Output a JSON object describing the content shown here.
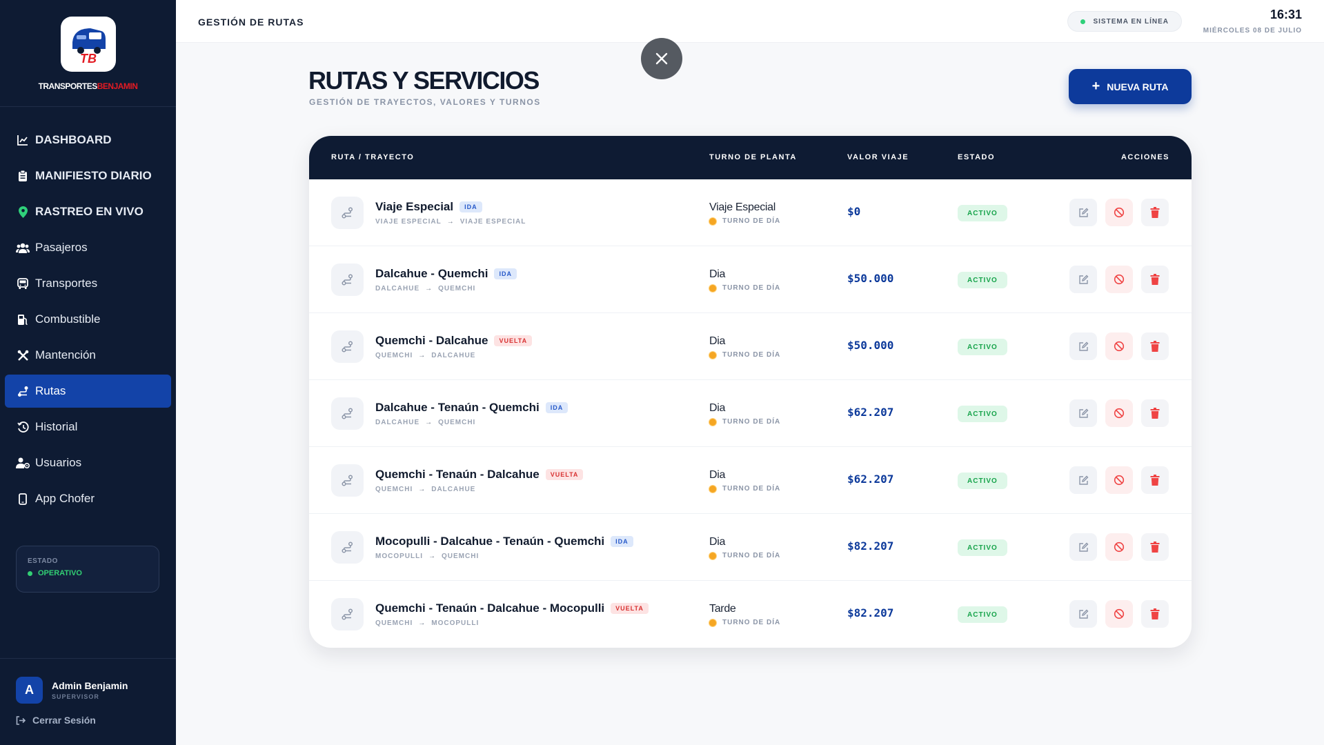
{
  "brand": {
    "logo_text": "TB",
    "name_main": "TRANSPORTES",
    "name_accent": "BENJAMIN"
  },
  "sidebar": {
    "items": [
      {
        "label": "DASHBOARD",
        "icon": "chart-line-icon"
      },
      {
        "label": "MANIFIESTO DIARIO",
        "icon": "clipboard-icon"
      },
      {
        "label": "RASTREO EN VIVO",
        "icon": "map-pin-icon"
      },
      {
        "label": "Pasajeros",
        "icon": "users-icon"
      },
      {
        "label": "Transportes",
        "icon": "bus-icon"
      },
      {
        "label": "Combustible",
        "icon": "fuel-pump-icon"
      },
      {
        "label": "Mantención",
        "icon": "tools-icon"
      },
      {
        "label": "Rutas",
        "icon": "route-icon"
      },
      {
        "label": "Historial",
        "icon": "history-icon"
      },
      {
        "label": "Usuarios",
        "icon": "user-gear-icon"
      },
      {
        "label": "App Chofer",
        "icon": "mobile-icon"
      }
    ],
    "status": {
      "label": "ESTADO",
      "value": "OPERATIVO"
    },
    "user": {
      "initial": "A",
      "name": "Admin Benjamin",
      "role": "SUPERVISOR"
    },
    "logout": "Cerrar Sesión"
  },
  "header": {
    "title": "GESTIÓN DE RUTAS",
    "system_status": "SISTEMA EN LÍNEA",
    "time": "16:31",
    "date": "MIÉRCOLES 08 DE JULIO"
  },
  "main": {
    "title": "RUTAS Y SERVICIOS",
    "subtitle": "GESTIÓN DE TRAYECTOS, VALORES Y TURNOS",
    "new_button": "NUEVA RUTA",
    "columns": {
      "route": "RUTA / TRAYECTO",
      "shift": "TURNO DE PLANTA",
      "value": "VALOR VIAJE",
      "state": "ESTADO",
      "actions": "ACCIONES"
    },
    "rows": [
      {
        "name": "Viaje Especial",
        "tag": "IDA",
        "from": "VIAJE ESPECIAL",
        "to": "VIAJE ESPECIAL",
        "shift": "Viaje Especial",
        "shift_sub": "TURNO DE DÍA",
        "value": "$0",
        "state": "ACTIVO"
      },
      {
        "name": "Dalcahue - Quemchi",
        "tag": "IDA",
        "from": "DALCAHUE",
        "to": "QUEMCHI",
        "shift": "Dia",
        "shift_sub": "TURNO DE DÍA",
        "value": "$50.000",
        "state": "ACTIVO"
      },
      {
        "name": "Quemchi - Dalcahue",
        "tag": "VUELTA",
        "from": "QUEMCHI",
        "to": "DALCAHUE",
        "shift": "Dia",
        "shift_sub": "TURNO DE DÍA",
        "value": "$50.000",
        "state": "ACTIVO"
      },
      {
        "name": "Dalcahue - Tenaún - Quemchi",
        "tag": "IDA",
        "from": "DALCAHUE",
        "to": "QUEMCHI",
        "shift": "Dia",
        "shift_sub": "TURNO DE DÍA",
        "value": "$62.207",
        "state": "ACTIVO"
      },
      {
        "name": "Quemchi - Tenaún - Dalcahue",
        "tag": "VUELTA",
        "from": "QUEMCHI",
        "to": "DALCAHUE",
        "shift": "Dia",
        "shift_sub": "TURNO DE DÍA",
        "value": "$62.207",
        "state": "ACTIVO"
      },
      {
        "name": "Mocopulli - Dalcahue - Tenaún - Quemchi",
        "tag": "IDA",
        "from": "MOCOPULLI",
        "to": "QUEMCHI",
        "shift": "Dia",
        "shift_sub": "TURNO DE DÍA",
        "value": "$82.207",
        "state": "ACTIVO"
      },
      {
        "name": "Quemchi - Tenaún - Dalcahue - Mocopulli",
        "tag": "VUELTA",
        "from": "QUEMCHI",
        "to": "MOCOPULLI",
        "shift": "Tarde",
        "shift_sub": "TURNO DE DÍA",
        "value": "$82.207",
        "state": "ACTIVO"
      }
    ]
  },
  "colors": {
    "navy": "#0e1b33",
    "primary": "#0d3a9b",
    "accent_red": "#e31b23",
    "success": "#16a34a"
  },
  "active_nav": "Rutas"
}
